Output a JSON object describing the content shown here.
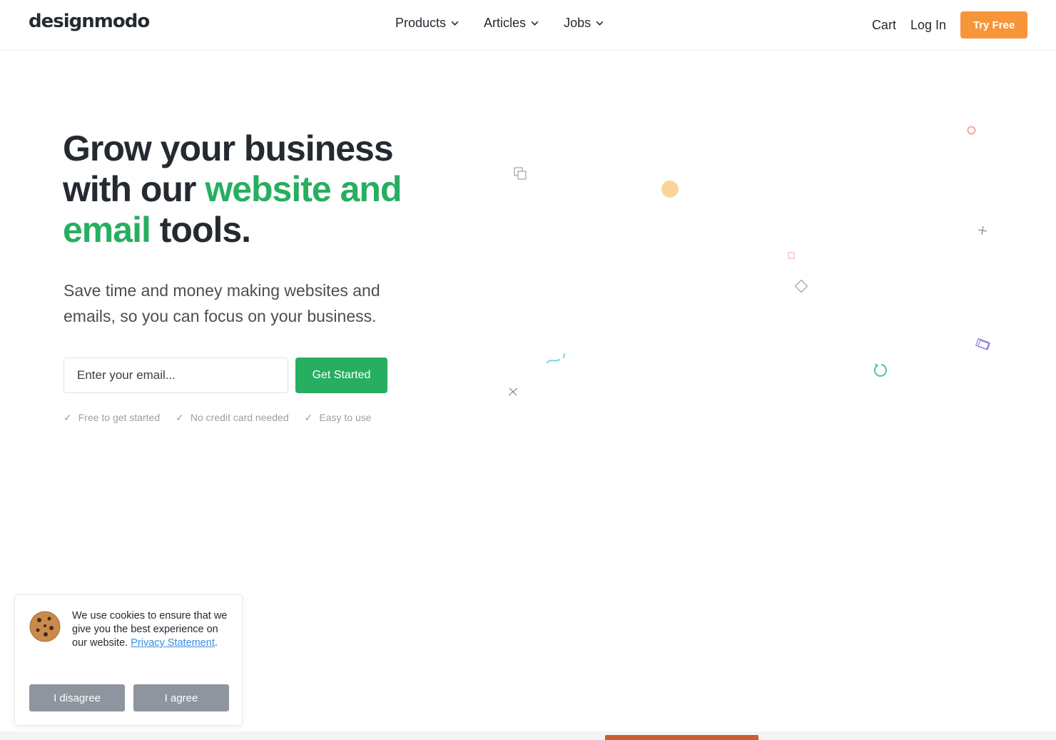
{
  "header": {
    "logo": "designmodo",
    "nav": [
      {
        "label": "Products"
      },
      {
        "label": "Articles"
      },
      {
        "label": "Jobs"
      }
    ],
    "cart_label": "Cart",
    "login_label": "Log In",
    "try_free_label": "Try Free"
  },
  "hero": {
    "title_part1": "Grow your business with our ",
    "title_accent": "website and email",
    "title_part2": " tools.",
    "subtitle": "Save time and money making websites and emails, so you can focus on your business.",
    "email_placeholder": "Enter your email...",
    "cta_label": "Get Started",
    "benefits": [
      {
        "check": "✓",
        "label": "Free to get started"
      },
      {
        "check": "✓",
        "label": "No credit card needed"
      },
      {
        "check": "✓",
        "label": "Easy to use"
      }
    ]
  },
  "cookie_banner": {
    "text": "We use cookies to ensure that we give you the best experience on our website.",
    "link_label": "Privacy Statement",
    "period": ".",
    "disagree_label": "I disagree",
    "agree_label": "I agree"
  },
  "colors": {
    "accent_green": "#27ae60",
    "try_free_orange": "#f7953a",
    "cookie_button_gray": "#8e959f",
    "link_blue": "#3c8dde"
  }
}
